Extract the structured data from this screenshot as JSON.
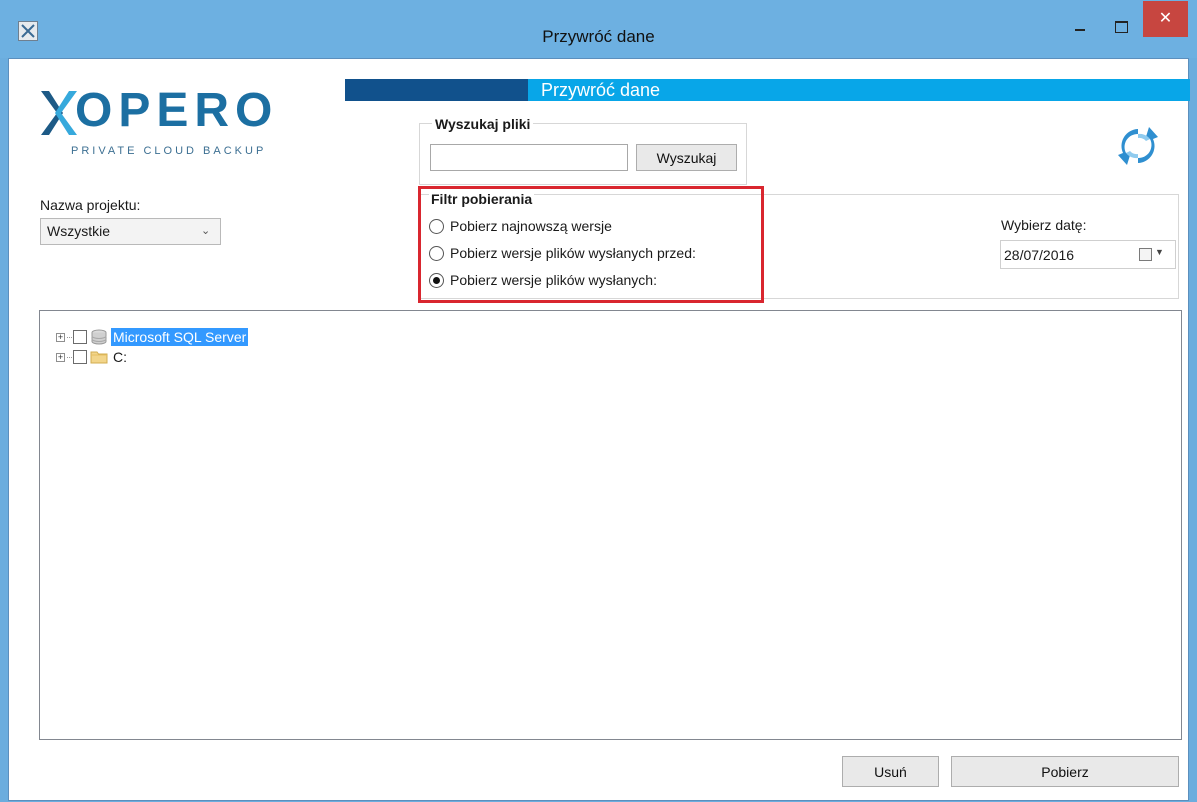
{
  "window": {
    "title": "Przywróć dane",
    "close_label": "✕",
    "app_icon": "app-icon"
  },
  "logo": {
    "wordmark": "OPERO",
    "tagline": "PRIVATE CLOUD BACKUP",
    "colors": {
      "x_dark": "#1d5a86",
      "x_light": "#36a9dc",
      "text": "#1c6fa2"
    }
  },
  "header": {
    "title": "Przywróć dane",
    "colors": {
      "dark": "#11518c",
      "light": "#08a6e8"
    }
  },
  "search": {
    "legend": "Wyszukaj pliki",
    "input_value": "",
    "button_label": "Wyszukaj"
  },
  "project": {
    "label": "Nazwa projektu:",
    "selected": "Wszystkie"
  },
  "filter": {
    "legend": "Filtr pobierania",
    "options": [
      {
        "label": "Pobierz najnowszą wersje",
        "checked": false
      },
      {
        "label": "Pobierz wersje plików wysłanych przed:",
        "checked": false
      },
      {
        "label": "Pobierz wersje plików wysłanych:",
        "checked": true
      }
    ],
    "highlight_color": "#d9262f"
  },
  "date": {
    "label": "Wybierz datę:",
    "value": "28/07/2016",
    "icon": "calendar-icon"
  },
  "tree": {
    "nodes": [
      {
        "label": "Microsoft SQL Server",
        "icon": "database-icon",
        "selected": true,
        "expander": "+"
      },
      {
        "label": "C:",
        "icon": "folder-icon",
        "selected": false,
        "expander": "+"
      }
    ]
  },
  "footer": {
    "delete_label": "Usuń",
    "download_label": "Pobierz"
  }
}
